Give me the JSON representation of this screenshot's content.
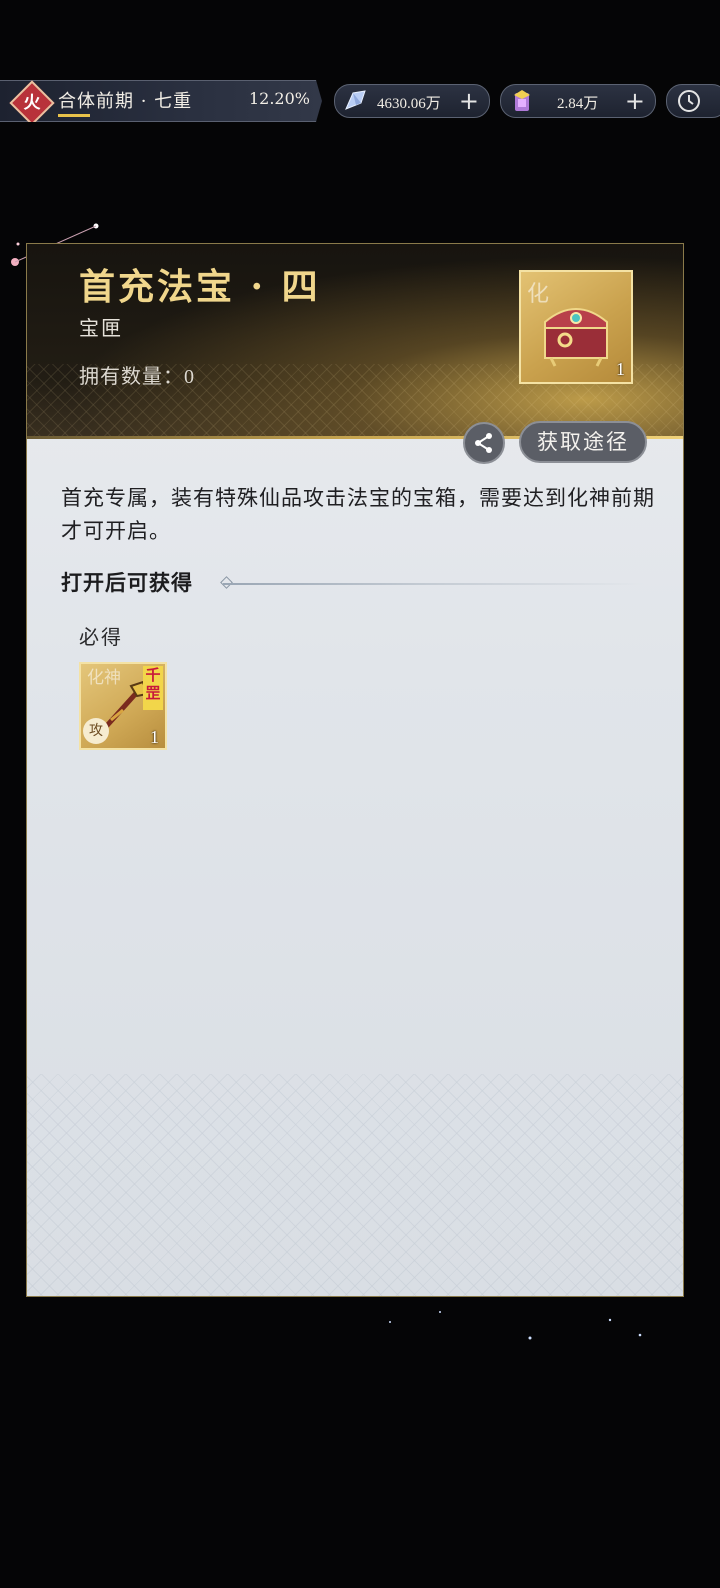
{
  "topbar": {
    "realm_element": "火",
    "realm_name": "合体前期 · 七重",
    "realm_progress": "12.20%",
    "spirit_stones": "4630.06万",
    "ingots": "2.84万"
  },
  "item": {
    "title": "首充法宝 · 四",
    "type": "宝匣",
    "owned_label": "拥有数量：",
    "owned_count": "0",
    "icon_count": "1",
    "icon_char": "化",
    "source_button": "获取途径",
    "description": "首充专属，装有特殊仙品攻击法宝的宝箱，需要达到化神前期才可开启。"
  },
  "rewards": {
    "section_title": "打开后可获得",
    "guaranteed_label": "必得",
    "items": [
      {
        "tag": "千罡",
        "attr": "攻",
        "count": "1",
        "char": "化神"
      }
    ]
  },
  "colors": {
    "title_gold": "#f0d68c",
    "panel_bg": "#e1e5ea",
    "badge_red": "#b8323a"
  }
}
